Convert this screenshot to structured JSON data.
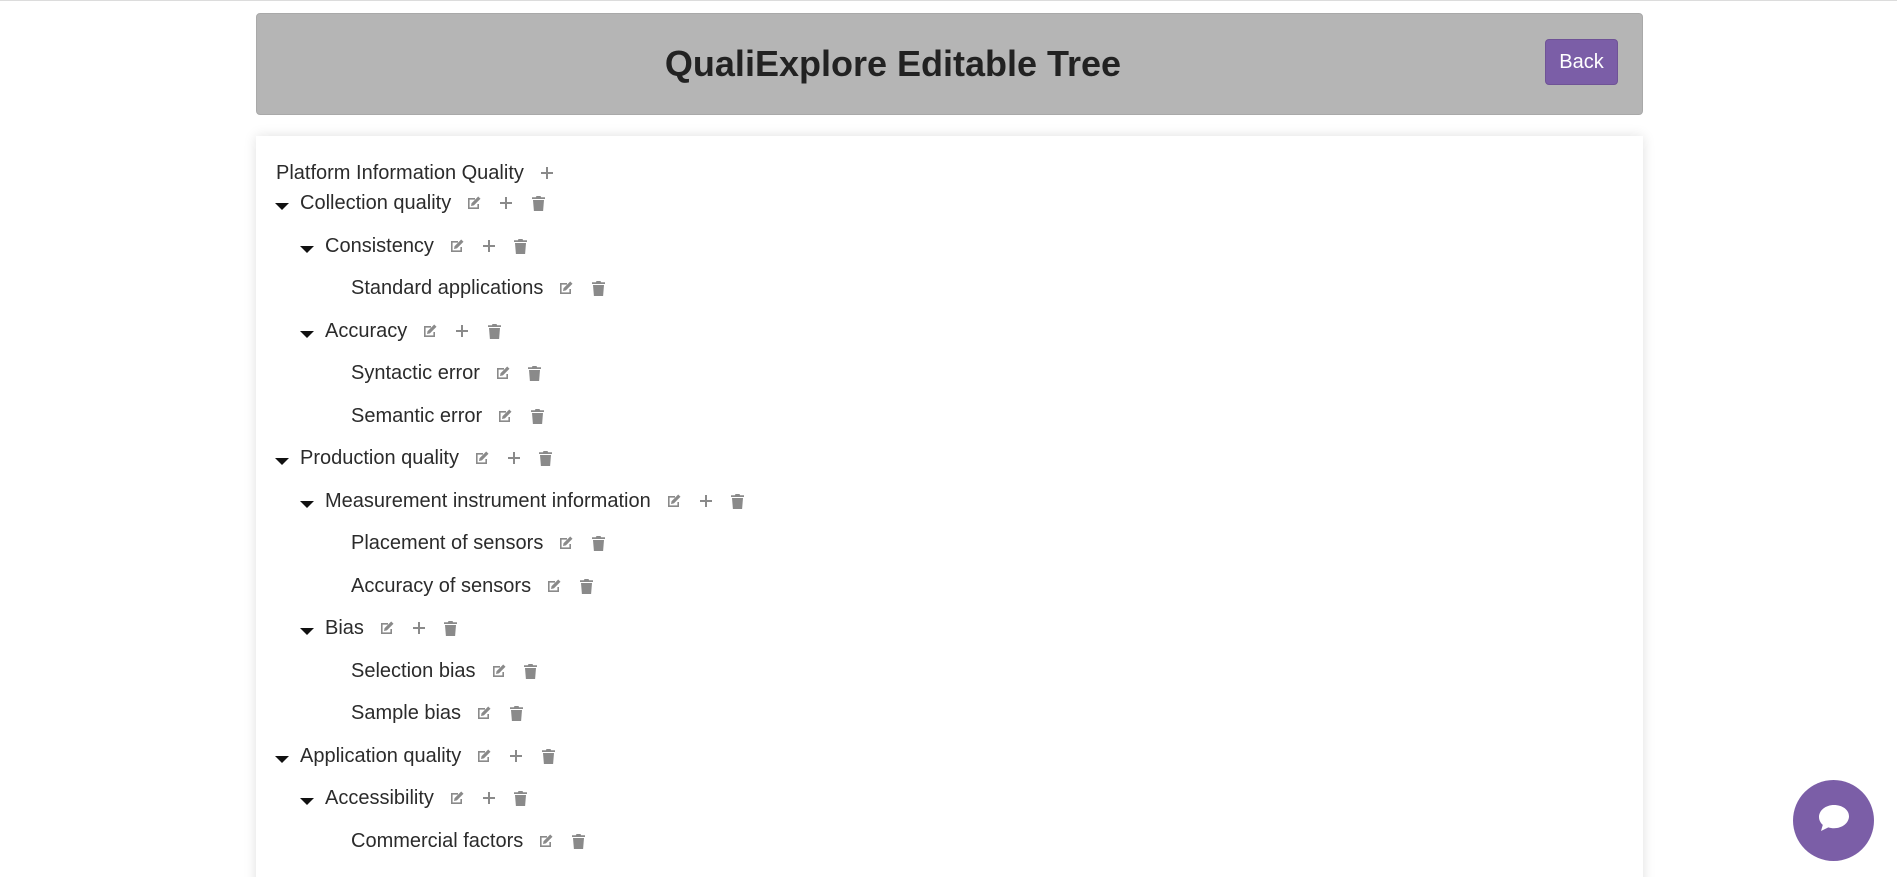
{
  "header": {
    "title": "QualiExplore Editable Tree",
    "back_label": "Back"
  },
  "colors": {
    "accent": "#7b5ea7",
    "header_bg": "#b5b5b5",
    "icon": "#8a8a8a"
  },
  "tree": {
    "root": {
      "label": "Platform Information Quality"
    },
    "nodes": [
      {
        "label": "Collection quality",
        "expandable": true,
        "actions": [
          "edit-icon",
          "plus-icon",
          "trash-icon"
        ]
      },
      {
        "label": "Consistency",
        "expandable": true,
        "actions": [
          "edit-icon",
          "plus-icon",
          "trash-icon"
        ]
      },
      {
        "label": "Standard applications",
        "expandable": false,
        "actions": [
          "edit-icon",
          "trash-icon"
        ]
      },
      {
        "label": "Accuracy",
        "expandable": true,
        "actions": [
          "edit-icon",
          "plus-icon",
          "trash-icon"
        ]
      },
      {
        "label": "Syntactic error",
        "expandable": false,
        "actions": [
          "edit-icon",
          "trash-icon"
        ]
      },
      {
        "label": "Semantic error",
        "expandable": false,
        "actions": [
          "edit-icon",
          "trash-icon"
        ]
      },
      {
        "label": "Production quality",
        "expandable": true,
        "actions": [
          "edit-icon",
          "plus-icon",
          "trash-icon"
        ]
      },
      {
        "label": "Measurement instrument information",
        "expandable": true,
        "actions": [
          "edit-icon",
          "plus-icon",
          "trash-icon"
        ]
      },
      {
        "label": "Placement of sensors",
        "expandable": false,
        "actions": [
          "edit-icon",
          "trash-icon"
        ]
      },
      {
        "label": "Accuracy of sensors",
        "expandable": false,
        "actions": [
          "edit-icon",
          "trash-icon"
        ]
      },
      {
        "label": "Bias",
        "expandable": true,
        "actions": [
          "edit-icon",
          "plus-icon",
          "trash-icon"
        ]
      },
      {
        "label": "Selection bias",
        "expandable": false,
        "actions": [
          "edit-icon",
          "trash-icon"
        ]
      },
      {
        "label": "Sample bias",
        "expandable": false,
        "actions": [
          "edit-icon",
          "trash-icon"
        ]
      },
      {
        "label": "Application quality",
        "expandable": true,
        "actions": [
          "edit-icon",
          "plus-icon",
          "trash-icon"
        ]
      },
      {
        "label": "Accessibility",
        "expandable": true,
        "actions": [
          "edit-icon",
          "plus-icon",
          "trash-icon"
        ]
      },
      {
        "label": "Commercial factors",
        "expandable": false,
        "actions": [
          "edit-icon",
          "trash-icon"
        ]
      }
    ]
  },
  "chat": {
    "icon": "chat-bubble-icon"
  }
}
